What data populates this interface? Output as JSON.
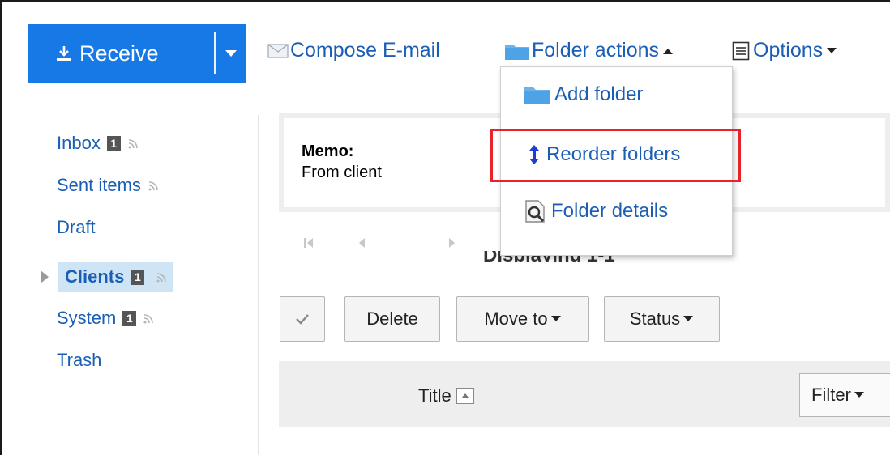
{
  "toolbar": {
    "receive_label": "Receive",
    "compose_label": "Compose E-mail",
    "folder_actions_label": "Folder actions",
    "options_label": "Options"
  },
  "folder_menu": {
    "items": [
      {
        "label": "Add folder",
        "icon": "folder-icon"
      },
      {
        "label": "Reorder folders",
        "icon": "reorder-icon",
        "highlighted": true
      },
      {
        "label": "Folder details",
        "icon": "folder-details-icon"
      }
    ]
  },
  "sidebar": {
    "items": [
      {
        "label": "Inbox",
        "count": "1",
        "rss": true
      },
      {
        "label": "Sent items",
        "rss": true
      },
      {
        "label": "Draft"
      },
      {
        "label": "Clients",
        "count": "1",
        "rss": true,
        "selected": true
      },
      {
        "label": "System",
        "count": "1",
        "rss": true
      },
      {
        "label": "Trash"
      }
    ]
  },
  "memo": {
    "title": "Memo:",
    "text": "From client"
  },
  "pager": {
    "text": "Displaying 1-1"
  },
  "actions": {
    "delete_label": "Delete",
    "move_label": "Move to",
    "status_label": "Status"
  },
  "table": {
    "title_header": "Title",
    "filter_label": "Filter"
  },
  "colors": {
    "primary": "#1779e6",
    "link": "#1a5fb4",
    "highlight": "#e8232a",
    "selected_bg": "#cfe5f6"
  }
}
